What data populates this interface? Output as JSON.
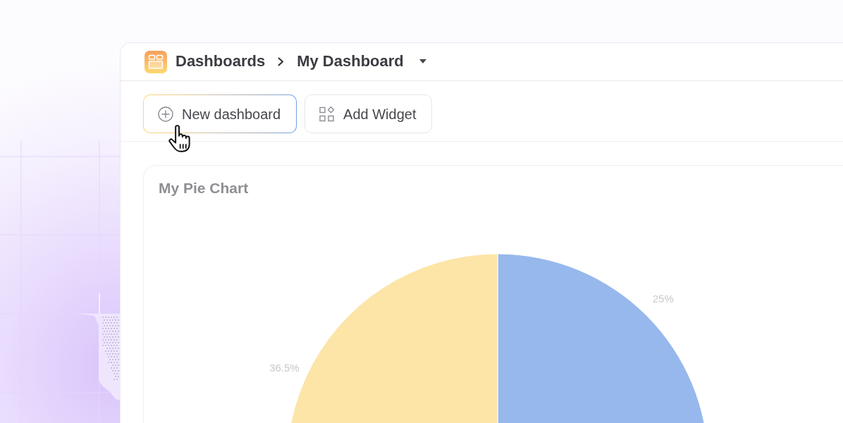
{
  "header": {
    "breadcrumb": [
      {
        "label": "Dashboards",
        "dropdown": false
      },
      {
        "label": "My Dashboard",
        "dropdown": true
      }
    ]
  },
  "toolbar": {
    "buttons": [
      {
        "kind": "create",
        "label": "New dashboard",
        "hovered": true
      },
      {
        "kind": "widget",
        "label": "Add Widget",
        "hovered": false
      }
    ]
  },
  "widgets": [
    {
      "title": "My Pie Chart",
      "chart_data": {
        "type": "pie",
        "values": [
          25,
          null,
          36.5
        ],
        "colors": [
          "#97b8ec",
          null,
          "#fde5a8"
        ],
        "value_labels": [
          "25%",
          null,
          "36.5%"
        ]
      }
    }
  ]
}
